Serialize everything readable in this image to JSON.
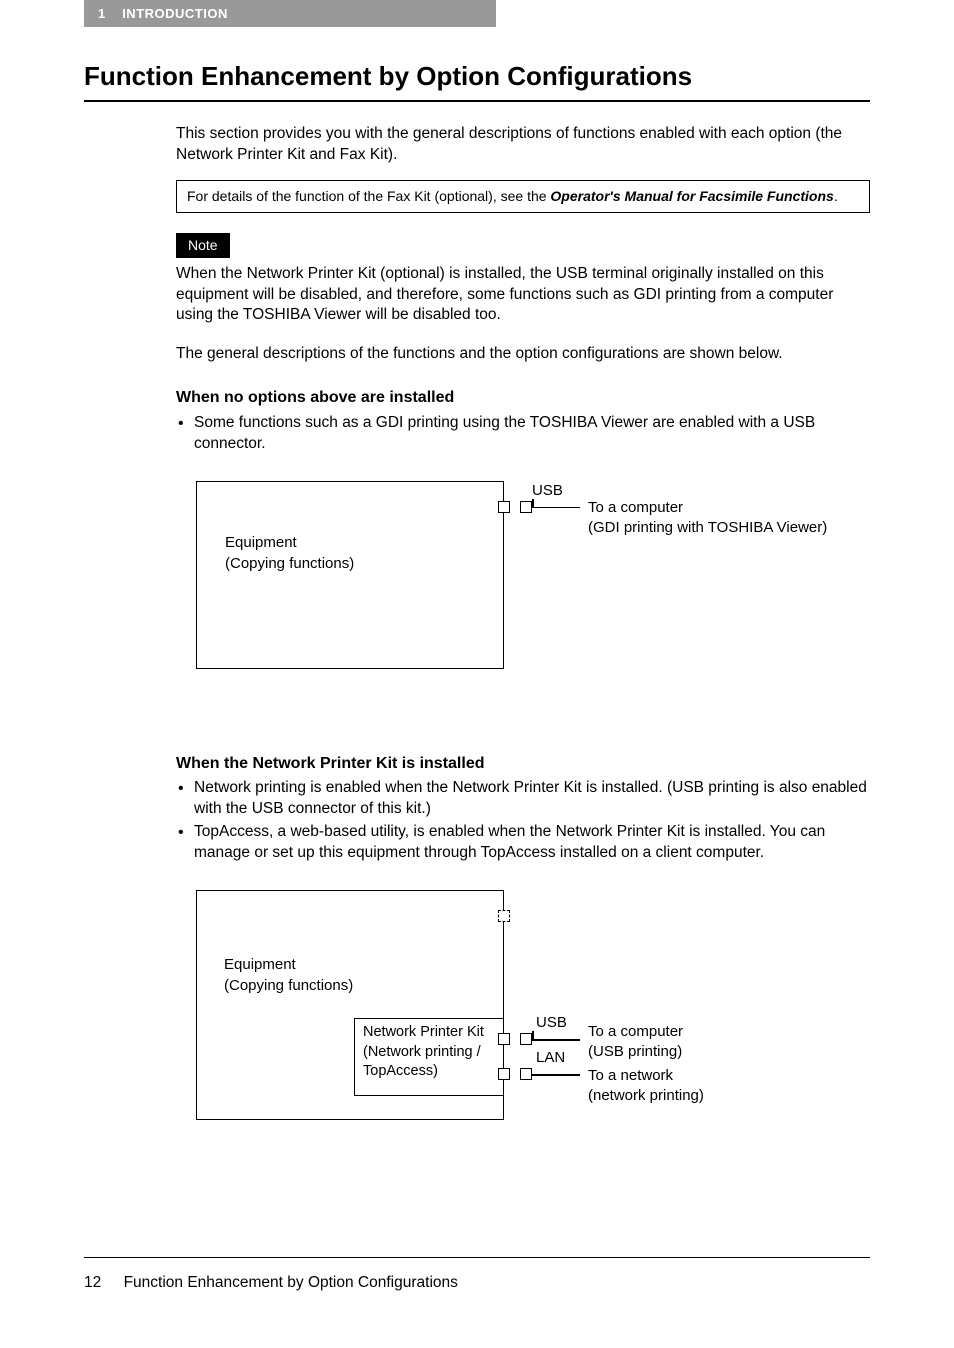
{
  "header": {
    "chapter_num": "1",
    "chapter_title": "INTRODUCTION"
  },
  "title": "Function Enhancement by Option Configurations",
  "intro": "This section provides you with the general descriptions of functions enabled with each option (the Network Printer Kit and Fax Kit).",
  "info_box": {
    "prefix": "For details of the function of the Fax Kit (optional), see the ",
    "bold": "Operator's Manual for Facsimile Functions",
    "suffix": "."
  },
  "note": {
    "label": "Note",
    "text": "When the Network Printer Kit (optional) is installed, the USB terminal originally installed on this equipment will be disabled, and therefore, some functions such as GDI printing from a computer using the TOSHIBA Viewer will be disabled too."
  },
  "general_desc": "The general descriptions of the functions and the option configurations are shown below.",
  "section1": {
    "heading": "When no options above are installed",
    "bullets": [
      "Some functions such as a GDI printing using the TOSHIBA Viewer are enabled with a USB connector."
    ],
    "diagram": {
      "equipment_line1": "Equipment",
      "equipment_line2": "(Copying functions)",
      "usb_label": "USB",
      "right_line1": "To a computer",
      "right_line2": "(GDI printing with TOSHIBA Viewer)"
    }
  },
  "section2": {
    "heading": "When the Network Printer Kit is installed",
    "bullets": [
      "Network printing is enabled when the Network Printer Kit is installed. (USB printing is also enabled with the USB connector of this kit.)",
      "TopAccess, a web-based utility, is enabled when the Network Printer Kit is installed. You can manage or set up this equipment through TopAccess installed on a client computer."
    ],
    "diagram": {
      "equipment_line1": "Equipment",
      "equipment_line2": "(Copying functions)",
      "npk_line1": "Network Printer Kit",
      "npk_line2": "(Network printing /",
      "npk_line3": "TopAccess)",
      "usb_label": "USB",
      "lan_label": "LAN",
      "usb_right1": "To a computer",
      "usb_right2": "(USB printing)",
      "lan_right1": "To a network",
      "lan_right2": "(network printing)"
    }
  },
  "footer": {
    "page_num": "12",
    "page_title": "Function Enhancement by Option Configurations"
  }
}
